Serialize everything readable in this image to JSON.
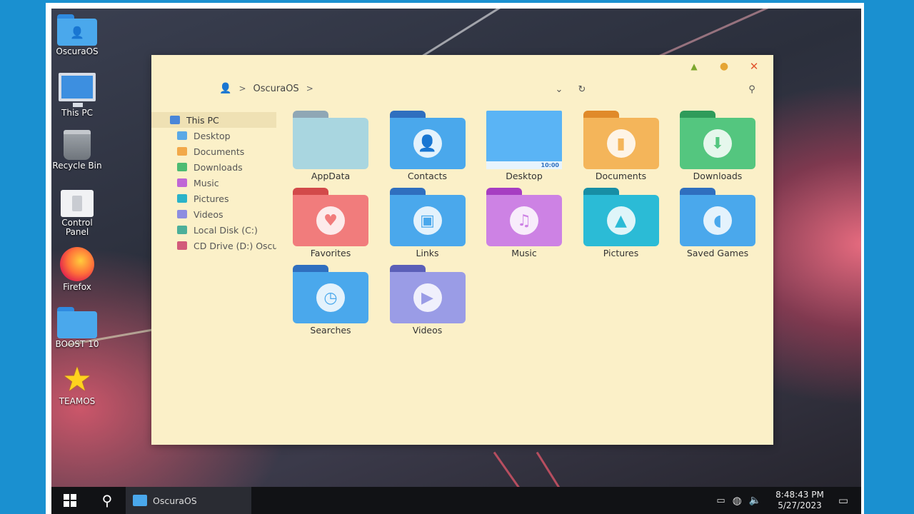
{
  "desktop": {
    "icons": [
      {
        "label": "OscuraOS"
      },
      {
        "label": "This PC"
      },
      {
        "label": "Recycle Bin"
      },
      {
        "label": "Control Panel"
      },
      {
        "label": "Firefox"
      },
      {
        "label": "BOOST 10"
      },
      {
        "label": "TEAMOS"
      }
    ]
  },
  "explorer": {
    "breadcrumb": {
      "root": "OscuraOS",
      "sep1": ">",
      "sep2": ">"
    },
    "controls": {
      "minimize": "▲",
      "maximize": "●",
      "close": "✕"
    },
    "nav": [
      {
        "label": "This PC",
        "color": "#4a86d8"
      },
      {
        "label": "Desktop",
        "color": "#5aa9e6"
      },
      {
        "label": "Documents",
        "color": "#f2a94a"
      },
      {
        "label": "Downloads",
        "color": "#4dbb73"
      },
      {
        "label": "Music",
        "color": "#c067d6"
      },
      {
        "label": "Pictures",
        "color": "#2bb3c9"
      },
      {
        "label": "Videos",
        "color": "#8d8de0"
      },
      {
        "label": "Local Disk (C:)",
        "color": "#4caf9a"
      },
      {
        "label": "CD Drive (D:) OscuraOS",
        "color": "#d25a7a"
      }
    ],
    "folders": [
      {
        "label": "AppData",
        "tab": "#8fa7b5",
        "body": "#a9d6e0",
        "icon": ""
      },
      {
        "label": "Contacts",
        "tab": "#2f6fbf",
        "body": "#4aa8ec",
        "icon": "👤"
      },
      {
        "label": "Desktop",
        "tab": "#5ab4f5",
        "body": "#5ab4f5",
        "icon": ""
      },
      {
        "label": "Documents",
        "tab": "#e08a2a",
        "body": "#f4b55a",
        "icon": "▮"
      },
      {
        "label": "Downloads",
        "tab": "#2f9b5a",
        "body": "#54c67f",
        "icon": "⬇"
      },
      {
        "label": "Favorites",
        "tab": "#d24a4a",
        "body": "#f17c7c",
        "icon": "♥"
      },
      {
        "label": "Links",
        "tab": "#2f6fbf",
        "body": "#4aa8ec",
        "icon": "▣"
      },
      {
        "label": "Music",
        "tab": "#a63dc2",
        "body": "#cd82e4",
        "icon": "♫"
      },
      {
        "label": "Pictures",
        "tab": "#178ea5",
        "body": "#2bbbd6",
        "icon": "▲"
      },
      {
        "label": "Saved Games",
        "tab": "#2f6fbf",
        "body": "#4aa8ec",
        "icon": "◖"
      },
      {
        "label": "Searches",
        "tab": "#2f6fbf",
        "body": "#4aa8ec",
        "icon": "◷"
      },
      {
        "label": "Videos",
        "tab": "#5b5fb8",
        "body": "#9a9ce6",
        "icon": "▶"
      }
    ],
    "desktop_preview_time": "10:00"
  },
  "taskbar": {
    "app_label": "OscuraOS",
    "time": "8:48:43 PM",
    "date": "5/27/2023"
  },
  "colors": {
    "window_bg": "#fbf0c8",
    "taskbar_bg": "#111215",
    "frame_bg": "#1a90d0"
  }
}
